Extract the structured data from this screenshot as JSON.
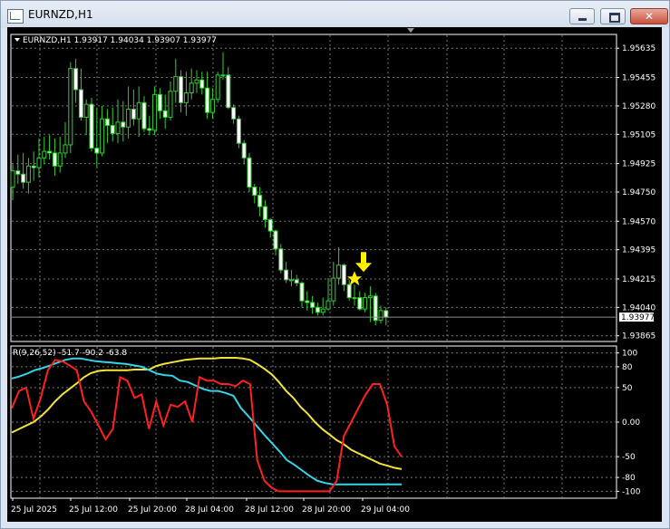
{
  "window": {
    "title": "EURNZD,H1",
    "close_glyph": "✕"
  },
  "icons": {
    "app": "chart-window-icon",
    "minimize": "minimize-icon",
    "maximize": "maximize-icon",
    "close": "close-icon",
    "arrow": "down-arrow-icon",
    "star": "star-icon"
  },
  "colors": {
    "background": "#000000",
    "grid": "#787878",
    "candle": "#32cd32",
    "osc_red": "#ff2020",
    "osc_cyan": "#35d4e6",
    "osc_yellow": "#f2e43c",
    "marker": "#ffee00"
  },
  "chart_data": [
    {
      "type": "candlestick",
      "header": "EURNZD,H1  1.93917 1.94034 1.93907 1.93977",
      "current_price": "1.93977",
      "y_ticks": [
        "1.95635",
        "1.95455",
        "1.95280",
        "1.95105",
        "1.94925",
        "1.94750",
        "1.94570",
        "1.94395",
        "1.94215",
        "1.94040",
        "1.93865"
      ],
      "ylim": [
        1.9383,
        1.9572
      ],
      "series": [
        {
          "name": "open",
          "values": [
            1.9478,
            1.9488,
            1.9486,
            1.9481,
            1.9491,
            1.949,
            1.9496,
            1.95,
            1.9499,
            1.9491,
            1.9499,
            1.9504,
            1.9551,
            1.9538,
            1.9521,
            1.9529,
            1.9502,
            1.9499,
            1.952,
            1.9516,
            1.9511,
            1.9518,
            1.9515,
            1.9526,
            1.952,
            1.953,
            1.9514,
            1.9513,
            1.9535,
            1.9525,
            1.9521,
            1.9537,
            1.9546,
            1.953,
            1.9536,
            1.9542,
            1.9544,
            1.9539,
            1.9524,
            1.9532,
            1.9547,
            1.9547,
            1.9527,
            1.952,
            1.9505,
            1.9496,
            1.9478,
            1.9473,
            1.9466,
            1.9458,
            1.9451,
            1.944,
            1.9427,
            1.9421,
            1.9421,
            1.9419,
            1.9408,
            1.9407,
            1.9404,
            1.9401,
            1.9403,
            1.9408,
            1.9422,
            1.943,
            1.9418,
            1.941,
            1.941,
            1.9403,
            1.941,
            1.9411,
            1.9396,
            1.9402
          ]
        },
        {
          "name": "high",
          "values": [
            1.9492,
            1.9498,
            1.9499,
            1.9496,
            1.95,
            1.9508,
            1.9509,
            1.951,
            1.9508,
            1.9509,
            1.9518,
            1.9555,
            1.9557,
            1.9551,
            1.9532,
            1.9533,
            1.9527,
            1.9528,
            1.9526,
            1.9527,
            1.9532,
            1.9531,
            1.954,
            1.9538,
            1.954,
            1.9534,
            1.9522,
            1.954,
            1.9539,
            1.9535,
            1.9543,
            1.9557,
            1.955,
            1.9549,
            1.9551,
            1.955,
            1.9549,
            1.9549,
            1.9539,
            1.9549,
            1.9561,
            1.9552,
            1.9529,
            1.9522,
            1.9507,
            1.9499,
            1.948,
            1.9478,
            1.947,
            1.9459,
            1.9452,
            1.9443,
            1.9432,
            1.9427,
            1.9424,
            1.942,
            1.9414,
            1.9411,
            1.9407,
            1.941,
            1.9422,
            1.9432,
            1.9441,
            1.9431,
            1.9421,
            1.9418,
            1.9414,
            1.9413,
            1.9417,
            1.9413,
            1.9405,
            1.9404
          ]
        },
        {
          "name": "low",
          "values": [
            1.947,
            1.948,
            1.9477,
            1.9474,
            1.9482,
            1.9484,
            1.9492,
            1.9495,
            1.9485,
            1.9487,
            1.9496,
            1.9499,
            1.953,
            1.9519,
            1.951,
            1.95,
            1.949,
            1.9497,
            1.9505,
            1.9506,
            1.9505,
            1.9506,
            1.9508,
            1.9516,
            1.9509,
            1.9512,
            1.951,
            1.951,
            1.952,
            1.9514,
            1.9519,
            1.953,
            1.9524,
            1.9522,
            1.9532,
            1.9536,
            1.9535,
            1.952,
            1.952,
            1.953,
            1.9544,
            1.9526,
            1.9517,
            1.9502,
            1.9492,
            1.9475,
            1.9468,
            1.946,
            1.9453,
            1.9447,
            1.9436,
            1.9425,
            1.9419,
            1.9417,
            1.9417,
            1.9404,
            1.9402,
            1.94,
            1.9399,
            1.9399,
            1.9402,
            1.9405,
            1.9418,
            1.9414,
            1.9408,
            1.9405,
            1.9402,
            1.9401,
            1.9395,
            1.9393,
            1.9394,
            1.9393
          ]
        },
        {
          "name": "close",
          "values": [
            1.9488,
            1.9486,
            1.9481,
            1.9491,
            1.949,
            1.9496,
            1.95,
            1.9499,
            1.9491,
            1.9499,
            1.9504,
            1.9551,
            1.9538,
            1.9521,
            1.9529,
            1.9502,
            1.9499,
            1.952,
            1.9516,
            1.9511,
            1.9518,
            1.9515,
            1.9526,
            1.952,
            1.953,
            1.9514,
            1.9513,
            1.9535,
            1.9525,
            1.9521,
            1.9537,
            1.9546,
            1.953,
            1.9536,
            1.9542,
            1.9544,
            1.9539,
            1.9524,
            1.9532,
            1.9547,
            1.9547,
            1.9527,
            1.952,
            1.9505,
            1.9496,
            1.9478,
            1.9473,
            1.9466,
            1.9458,
            1.9451,
            1.944,
            1.9427,
            1.9421,
            1.9421,
            1.9419,
            1.9408,
            1.9407,
            1.9404,
            1.9401,
            1.9403,
            1.9408,
            1.9422,
            1.943,
            1.9418,
            1.941,
            1.941,
            1.9403,
            1.941,
            1.9411,
            1.9396,
            1.9402,
            1.9398
          ]
        }
      ]
    },
    {
      "type": "line",
      "header": "R(9,26,52) -51.7 -90.2 -63.8",
      "y_ticks": [
        "100",
        "80",
        "50",
        "0.00",
        "-50",
        "-80",
        "-100"
      ],
      "ylim": [
        -110,
        110
      ],
      "x_tick_labels": [
        "25 Jul 2025",
        "25 Jul 12:00",
        "25 Jul 20:00",
        "28 Jul 04:00",
        "28 Jul 12:00",
        "28 Jul 20:00",
        "29 Jul 04:00"
      ],
      "series": [
        {
          "name": "R9",
          "values": [
            20,
            45,
            50,
            5,
            35,
            75,
            90,
            88,
            82,
            75,
            30,
            15,
            -5,
            -25,
            -10,
            65,
            60,
            35,
            40,
            -10,
            30,
            -5,
            25,
            22,
            30,
            0,
            65,
            60,
            60,
            55,
            55,
            52,
            60,
            55,
            -55,
            -85,
            -95,
            -100,
            -100,
            -100,
            -100,
            -100,
            -100,
            -100,
            -100,
            -85,
            -20,
            0,
            20,
            40,
            55,
            55,
            25,
            -35,
            -50
          ]
        },
        {
          "name": "R26",
          "values": [
            63,
            66,
            70,
            75,
            78,
            82,
            86,
            90,
            92,
            92,
            90,
            88,
            87,
            86,
            85,
            84,
            82,
            80,
            75,
            70,
            68,
            67,
            60,
            58,
            53,
            48,
            45,
            45,
            42,
            38,
            20,
            8,
            -5,
            -18,
            -30,
            -42,
            -55,
            -62,
            -70,
            -78,
            -85,
            -88,
            -90,
            -90,
            -90,
            -90,
            -90,
            -90,
            -90,
            -90,
            -90,
            -90
          ]
        },
        {
          "name": "R52",
          "values": [
            -15,
            -10,
            -5,
            0,
            8,
            18,
            30,
            40,
            48,
            56,
            65,
            71,
            74,
            75,
            75,
            75,
            75,
            76,
            76,
            76,
            81,
            84,
            86,
            88,
            90,
            91,
            92,
            92,
            92,
            93,
            93,
            93,
            92,
            90,
            84,
            77,
            69,
            58,
            45,
            35,
            22,
            12,
            0,
            -10,
            -18,
            -26,
            -32,
            -40,
            -45,
            -50,
            -55,
            -60,
            -63,
            -66,
            -68
          ]
        }
      ]
    }
  ]
}
